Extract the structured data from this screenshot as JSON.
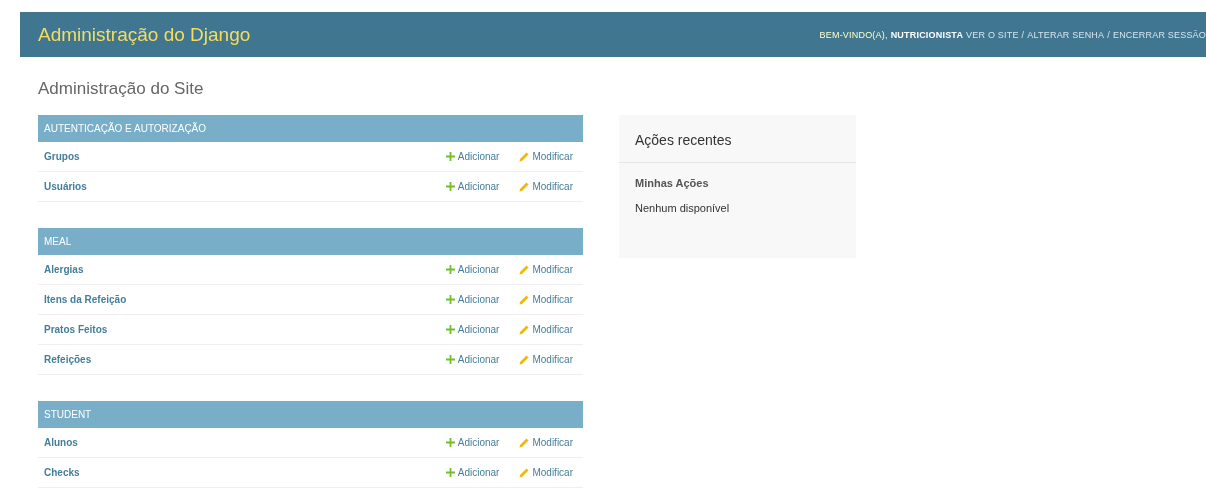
{
  "header": {
    "branding": "Administração do Django",
    "welcome": "BEM-VINDO(A),",
    "username": "NUTRICIONISTA",
    "links": [
      "VER O SITE",
      "ALTERAR SENHA",
      "ENCERRAR SESSÃO"
    ],
    "separator": "/"
  },
  "page_title": "Administração do Site",
  "modules": [
    {
      "caption": "AUTENTICAÇÃO E AUTORIZAÇÃO",
      "models": [
        {
          "name": "Grupos",
          "add": "Adicionar",
          "change": "Modificar"
        },
        {
          "name": "Usuários",
          "add": "Adicionar",
          "change": "Modificar"
        }
      ]
    },
    {
      "caption": "MEAL",
      "models": [
        {
          "name": "Alergias",
          "add": "Adicionar",
          "change": "Modificar"
        },
        {
          "name": "Itens da Refeição",
          "add": "Adicionar",
          "change": "Modificar"
        },
        {
          "name": "Pratos Feitos",
          "add": "Adicionar",
          "change": "Modificar"
        },
        {
          "name": "Refeições",
          "add": "Adicionar",
          "change": "Modificar"
        }
      ]
    },
    {
      "caption": "STUDENT",
      "models": [
        {
          "name": "Alunos",
          "add": "Adicionar",
          "change": "Modificar"
        },
        {
          "name": "Checks",
          "add": "Adicionar",
          "change": "Modificar"
        }
      ]
    }
  ],
  "recent_actions": {
    "title": "Ações recentes",
    "subtitle": "Minhas Ações",
    "empty": "Nenhum disponível"
  }
}
